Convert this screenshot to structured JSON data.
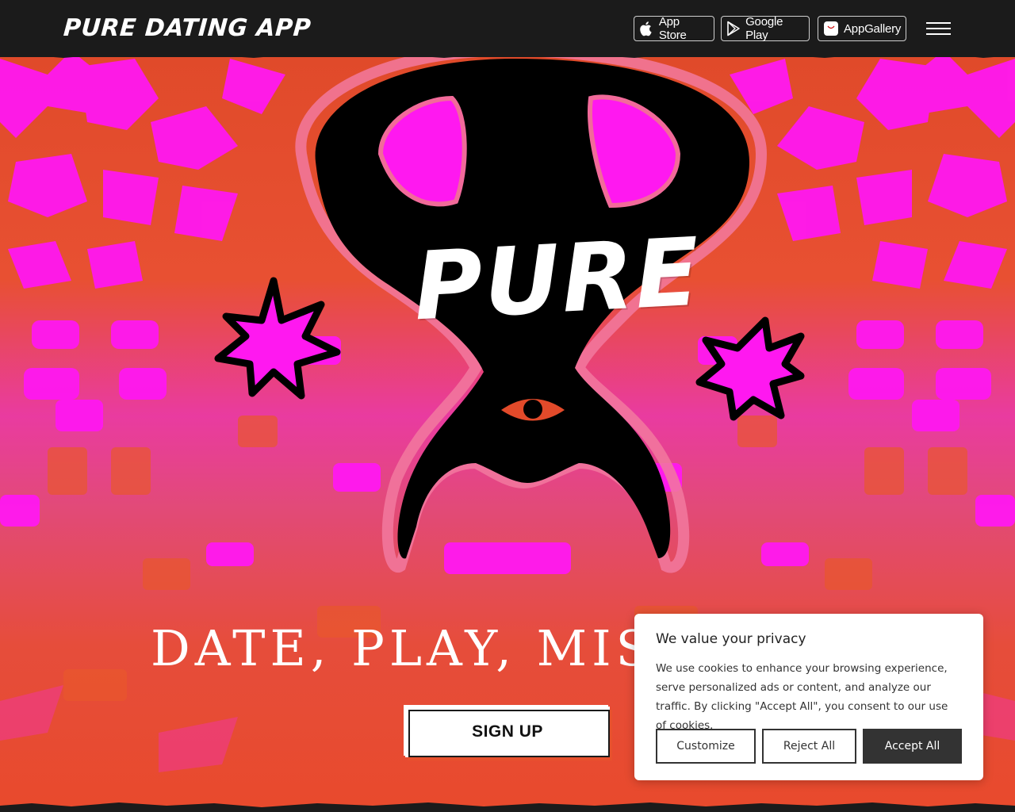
{
  "header": {
    "brand": "PURE DATING APP",
    "stores": [
      {
        "label": "App Store",
        "icon": "apple-icon"
      },
      {
        "label": "Google Play",
        "icon": "google-play-icon"
      },
      {
        "label": "AppGallery",
        "icon": "appgallery-icon"
      }
    ],
    "menu_icon": "hamburger-menu-icon"
  },
  "hero": {
    "logo_text": "PURE",
    "tagline": "DATE, PLAY, MISE",
    "signup_label": "SIGN UP",
    "colors": {
      "orange": "#e24a2a",
      "magenta": "#ff16f2",
      "black": "#000000",
      "pink_outline": "#f26a9a"
    }
  },
  "cookie": {
    "title": "We value your privacy",
    "text": "We use cookies to enhance your browsing experience, serve personalized ads or content, and analyze our traffic. By clicking \"Accept All\", you consent to our use of cookies.",
    "buttons": {
      "customize": "Customize",
      "reject": "Reject All",
      "accept": "Accept All"
    }
  }
}
